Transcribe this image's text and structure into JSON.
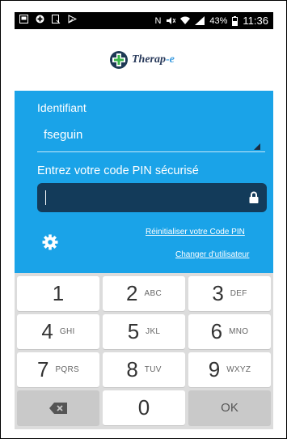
{
  "status_bar": {
    "time": "11:36",
    "battery": "43%",
    "network_indicator": "N"
  },
  "app": {
    "logo_text_main": "Therap",
    "logo_text_accent": "-e"
  },
  "login": {
    "identifiant_label": "Identifiant",
    "username": "fseguin",
    "pin_label": "Entrez votre code PIN sécurisé",
    "reset_pin_link": "Réinitialiser votre Code PIN",
    "change_user_link": "Changer d'utilisateur"
  },
  "keypad": {
    "keys": [
      {
        "digit": "1",
        "letters": ""
      },
      {
        "digit": "2",
        "letters": "ABC"
      },
      {
        "digit": "3",
        "letters": "DEF"
      },
      {
        "digit": "4",
        "letters": "GHI"
      },
      {
        "digit": "5",
        "letters": "JKL"
      },
      {
        "digit": "6",
        "letters": "MNO"
      },
      {
        "digit": "7",
        "letters": "PQRS"
      },
      {
        "digit": "8",
        "letters": "TUV"
      },
      {
        "digit": "9",
        "letters": "WXYZ"
      }
    ],
    "zero": "0",
    "ok": "OK"
  },
  "colors": {
    "accent_blue": "#1aa3e8",
    "pin_field": "#133b5a"
  }
}
